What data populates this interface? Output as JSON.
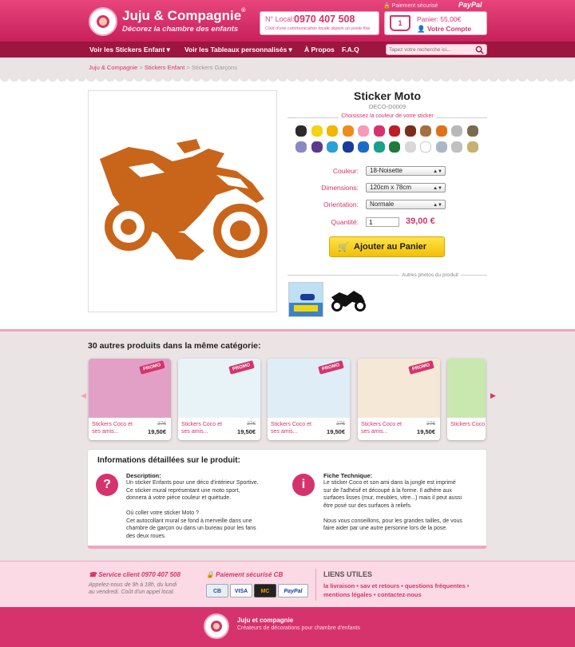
{
  "header": {
    "brand_name": "Juju & Compagnie",
    "brand_reg": "®",
    "tagline": "Décorez la chambre des enfants",
    "phone_label": "N° Local:",
    "phone_number": "0970 407 508",
    "phone_note": "Coût d'une communication locale depuis un poste fixe",
    "secure_note": "🔒 Paiement sécurisé",
    "paypal": "PayPal",
    "cart_count": "1",
    "cart_total": "Panier: 55,00€",
    "account_label": "👤 Votre Compte"
  },
  "nav": {
    "items": [
      "Voir les Stickers Enfant ▾",
      "Voir les Tableaux personnalisés ▾",
      "À Propos",
      "F.A.Q"
    ],
    "search_placeholder": "Tapez votre recherche ici..."
  },
  "breadcrumb": {
    "items": [
      "Juju & Compagnie",
      "Stickers Enfant",
      "Stickers Garçons"
    ],
    "separator": " > "
  },
  "product": {
    "title": "Sticker Moto",
    "ref": "DECO-D0009",
    "color_prompt": "Choisissez la couleur de votre sticker",
    "swatches": [
      "#2b2b2b",
      "#f3d412",
      "#f4b400",
      "#f08a1c",
      "#f59bb8",
      "#d6336c",
      "#c01e26",
      "#7a2f1e",
      "#a6703d",
      "#e0711c",
      "#b8b8b8",
      "#7c6a50",
      "#8a88c4",
      "#5a3a8c",
      "#2aa0d8",
      "#1a3a9c",
      "#1b6cc6",
      "#18a08a",
      "#1d7a3a",
      "#d8d8d8",
      "#ffffff",
      "#a8b8c8",
      "#c0c0c0",
      "#c8b070"
    ],
    "selected_color": "#c8651a",
    "options": [
      {
        "label": "Couleur:",
        "value": "18-Noisette"
      },
      {
        "label": "Dimensions:",
        "value": "120cm x 78cm"
      },
      {
        "label": "Orientation:",
        "value": "Normale"
      }
    ],
    "qty_label": "Quantité:",
    "qty_value": "1",
    "price": "39,00 €",
    "add_to_cart": "Ajouter au Panier",
    "other_photos": "Autres photos du produit"
  },
  "catalog": {
    "title": "30 autres produits dans la même catégorie:",
    "items": [
      {
        "name": "Stickers Coco et ses amis...",
        "old": "27€",
        "price": "19,50€",
        "promo": "PROMO",
        "bg": "#e3a0c6"
      },
      {
        "name": "Stickers Coco et ses amis...",
        "old": "27€",
        "price": "19,50€",
        "promo": "PROMO",
        "bg": "#e8f3f8"
      },
      {
        "name": "Stickers Coco et ses amis...",
        "old": "27€",
        "price": "19,50€",
        "promo": "PROMO",
        "bg": "#dfeef6"
      },
      {
        "name": "Stickers Coco et ses amis...",
        "old": "27€",
        "price": "19,50€",
        "promo": "PROMO",
        "bg": "#f6e8d6"
      },
      {
        "name": "Stickers Coco",
        "old": "",
        "price": "",
        "promo": "",
        "bg": "#c8e8b0"
      }
    ]
  },
  "details": {
    "title": "Informations détaillées sur le produit:",
    "description_head": "Description:",
    "description_text": "Un sticker Enfants pour une déco d'intérieur Sportive.\nCe sticker mural représentant une moto sport,\ndonnera à votre pièce couleur et quiétude.\n\nOù coller votre sticker Moto ?\nCet autocollant mural se fond à merveille dans une\nchambre de garçon ou dans un bureau pour les fans\ndes deux roues.",
    "tech_head": "Fiche Technique:",
    "tech_text": "Le sticker Coco et son ami dans la jungle est imprimé\nsur de l'adhésif et découpé à la forme. Il adhère aux\nsurfaces lisses (mur, meubles, vitre...) mais il peut aussi\nêtre posé sur des surfaces à reliefs.\n\nNous vous conseillons, pour les grandes tailles, de vous\nfaire aider par une autre personne lors de la pose.",
    "q_badge": "?",
    "i_badge": "i"
  },
  "footer": {
    "service_head": "☎ Service client 0970 407 508",
    "service_text": "Appelez-nous de 9h à 18h, du lundi\nau vendredi. Coût d'un appel local.",
    "pay_head": "🔒 Paiement sécurisé CB",
    "pay_cards": [
      "CB",
      "VISA",
      "MC",
      "PayPal"
    ],
    "links_head": "LIENS UTILES",
    "links_text": "la livraison • sav et retours • questions fréquentes • mentions légales • contactez-nous",
    "brand": "Juju et compagnie",
    "slogan": "Créateurs de décorations pour chambre d'enfants"
  }
}
